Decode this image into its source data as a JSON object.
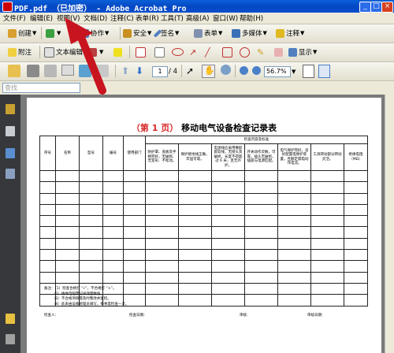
{
  "window": {
    "title": "PDF.pdf （已加密） - Adobe Acrobat Pro"
  },
  "menu": [
    {
      "label": "文件(F)"
    },
    {
      "label": "编辑(E)"
    },
    {
      "label": "视图(V)"
    },
    {
      "label": "文档(D)"
    },
    {
      "label": "注释(C)"
    },
    {
      "label": "表单(R)"
    },
    {
      "label": "工具(T)"
    },
    {
      "label": "高级(A)"
    },
    {
      "label": "窗口(W)"
    },
    {
      "label": "帮助(H)"
    }
  ],
  "toolbar1": {
    "create": "创建",
    "collaborate": "协作",
    "secure": "安全",
    "sign": "签名",
    "forms": "表单",
    "multimedia": "多媒体",
    "comment": "注释"
  },
  "toolbar2": {
    "attach": "附注",
    "text_edit": "文本编辑",
    "show": "显示"
  },
  "toolbar3": {
    "page_current": "1",
    "page_total": "/ 4",
    "zoom": "56.7%"
  },
  "search": {
    "placeholder": "查找"
  },
  "document": {
    "title_prefix": "（第 1 页）",
    "title": "移动电气设备检查记录表",
    "group_header": "检查内容及标准",
    "columns": [
      "序号",
      "名称",
      "型号",
      "编号",
      "使用部门",
      "防护罩、盖板及手柄完好，无破损、无变形、不松动。",
      "保护接地线正确，牢固可靠。",
      "电源线应采用橡胶套软线，无接头及破损，长度不得超过 6 米，且无外护。",
      "开关动作灵敏，可靠，插头无破损，插座与电源匹配。",
      "电气保护完好，良好配置电保护装置，且额定漏电动作电流。",
      "工具转动部分转动灵活。",
      "绝缘电阻（MΩ）"
    ],
    "notes": [
      "备注：（1）检查合格打 “√”，不合格打 “×”。",
      "（2）绝缘电阻需记录测量数值。",
      "（3）不合格项目需及时整改并复检。",
      "（4）此表由设备管理员填写，每季度检查一次。"
    ],
    "inspector_label": "检查人：",
    "date_label": "检查日期：",
    "reviewer_label": "审核：",
    "review_date_label": "审核日期："
  },
  "colors": {
    "titlebar": "#0347c2",
    "title_red": "#d62828",
    "arrow": "#c8141e"
  }
}
